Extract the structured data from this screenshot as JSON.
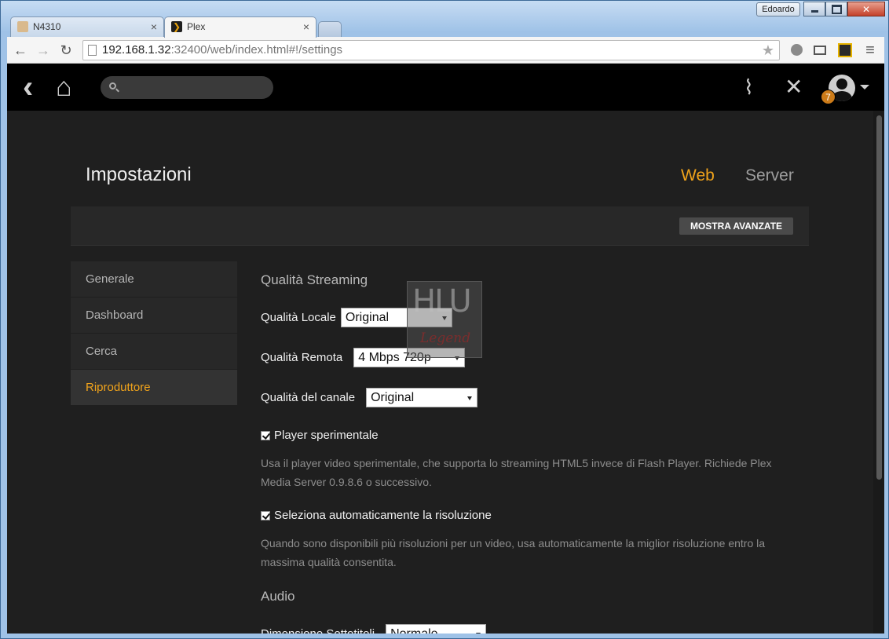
{
  "window": {
    "user_label": "Edoardo",
    "controls": {
      "minimize": "",
      "maximize": "",
      "close": "✕"
    }
  },
  "tabs": [
    {
      "title": "N4310",
      "close": "×",
      "active": false
    },
    {
      "title": "Plex",
      "close": "×",
      "active": true
    }
  ],
  "toolbar": {
    "back": "←",
    "forward": "→",
    "reload": "↻",
    "url_host": "192.168.1.32",
    "url_rest": ":32400/web/index.html#!/settings",
    "bookmark": "★",
    "menu": "≡"
  },
  "plex_header": {
    "back_icon": "‹",
    "home_icon": "⌂",
    "activity_icon": "⌇",
    "settings_icon": "✕",
    "notification_count": "7"
  },
  "settings": {
    "title": "Impostazioni",
    "tabs": {
      "web": "Web",
      "server": "Server"
    },
    "show_advanced": "MOSTRA AVANZATE",
    "sidebar": [
      {
        "label": "Generale",
        "active": false
      },
      {
        "label": "Dashboard",
        "active": false
      },
      {
        "label": "Cerca",
        "active": false
      },
      {
        "label": "Riproduttore",
        "active": true
      }
    ],
    "streaming": {
      "title": "Qualità Streaming",
      "local_label": "Qualità Locale",
      "local_value": "Original",
      "remote_label": "Qualità Remota",
      "remote_value": "4 Mbps 720p",
      "channel_label": "Qualità del canale",
      "channel_value": "Original",
      "experimental_label": "Player sperimentale",
      "experimental_checked": true,
      "experimental_help": "Usa il player video sperimentale, che supporta lo streaming HTML5 invece di Flash Player. Richiede Plex Media Server 0.9.8.6 o successivo.",
      "auto_res_label": "Seleziona automaticamente la risoluzione",
      "auto_res_checked": true,
      "auto_res_help": "Quando sono disponibili più risoluzioni per un video, usa automaticamente la miglior risoluzione entro la massima qualità consentita."
    },
    "audio": {
      "title": "Audio",
      "subtitle_size_label": "Dimensione Sottotitoli",
      "subtitle_size_value": "Normale"
    }
  },
  "watermark": {
    "line1": "HLU",
    "line2": "Legend"
  }
}
